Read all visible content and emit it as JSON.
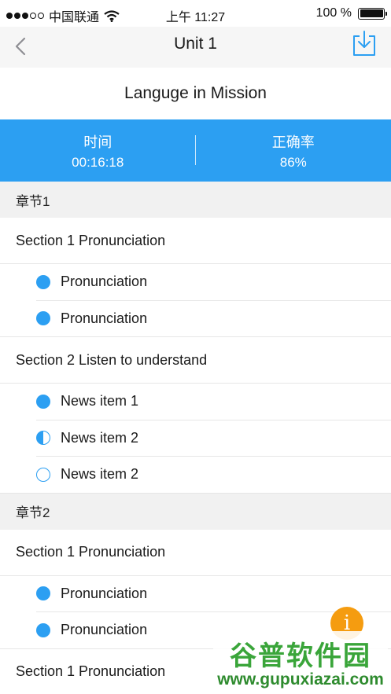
{
  "status_bar": {
    "carrier": "中国联通",
    "time": "上午 11:27",
    "battery_text": "100 %"
  },
  "nav": {
    "title": "Unit 1"
  },
  "course": {
    "title": "Languge in Mission"
  },
  "stats": {
    "time_label": "时间",
    "time_value": "00:16:18",
    "accuracy_label": "正确率",
    "accuracy_value": "86%"
  },
  "chapters": [
    {
      "label": "章节1",
      "sections": [
        {
          "title": "Section 1 Pronunciation",
          "items": [
            {
              "label": "Pronunciation",
              "status": "full"
            },
            {
              "label": "Pronunciation",
              "status": "full"
            }
          ]
        },
        {
          "title": "Section 2 Listen to understand",
          "items": [
            {
              "label": "News item 1",
              "status": "full"
            },
            {
              "label": "News item 2",
              "status": "half"
            },
            {
              "label": "News item 2",
              "status": "empty"
            }
          ]
        }
      ]
    },
    {
      "label": "章节2",
      "sections": [
        {
          "title": "Section 1 Pronunciation",
          "items": [
            {
              "label": "Pronunciation",
              "status": "full"
            },
            {
              "label": "Pronunciation",
              "status": "full"
            }
          ]
        },
        {
          "title": "Section 1 Pronunciation",
          "items": []
        }
      ]
    }
  ],
  "fab": {
    "icon": "info-icon",
    "glyph": "i",
    "color": "#f59c10"
  },
  "watermark": {
    "title": "谷普软件园",
    "url": "www.gupuxiazai.com"
  },
  "colors": {
    "accent": "#2c9ff2",
    "chapter_bg": "#f1f1f1",
    "nav_bg": "#f6f6f6"
  }
}
